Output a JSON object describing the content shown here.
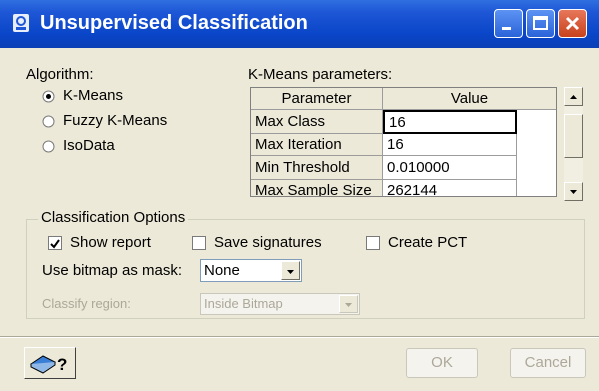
{
  "window": {
    "title": "Unsupervised Classification"
  },
  "algorithm": {
    "label": "Algorithm:",
    "options": [
      {
        "label": "K-Means",
        "selected": true
      },
      {
        "label": "Fuzzy K-Means",
        "selected": false
      },
      {
        "label": "IsoData",
        "selected": false
      }
    ]
  },
  "params": {
    "label": "K-Means parameters:",
    "headers": [
      "Parameter",
      "Value"
    ],
    "rows": [
      {
        "name": "Max Class",
        "value": "16"
      },
      {
        "name": "Max Iteration",
        "value": "16"
      },
      {
        "name": "Min Threshold",
        "value": "0.010000"
      },
      {
        "name": "Max Sample Size",
        "value": "262144"
      }
    ]
  },
  "options_group": {
    "title": "Classification Options",
    "show_report": {
      "label": "Show report",
      "checked": true
    },
    "save_signatures": {
      "label": "Save signatures",
      "checked": false
    },
    "create_pct": {
      "label": "Create PCT",
      "checked": false
    },
    "bitmap_mask": {
      "label": "Use bitmap as mask:",
      "value": "None"
    },
    "classify_region": {
      "label": "Classify region:",
      "value": "Inside Bitmap"
    }
  },
  "buttons": {
    "ok": "OK",
    "cancel": "Cancel"
  }
}
